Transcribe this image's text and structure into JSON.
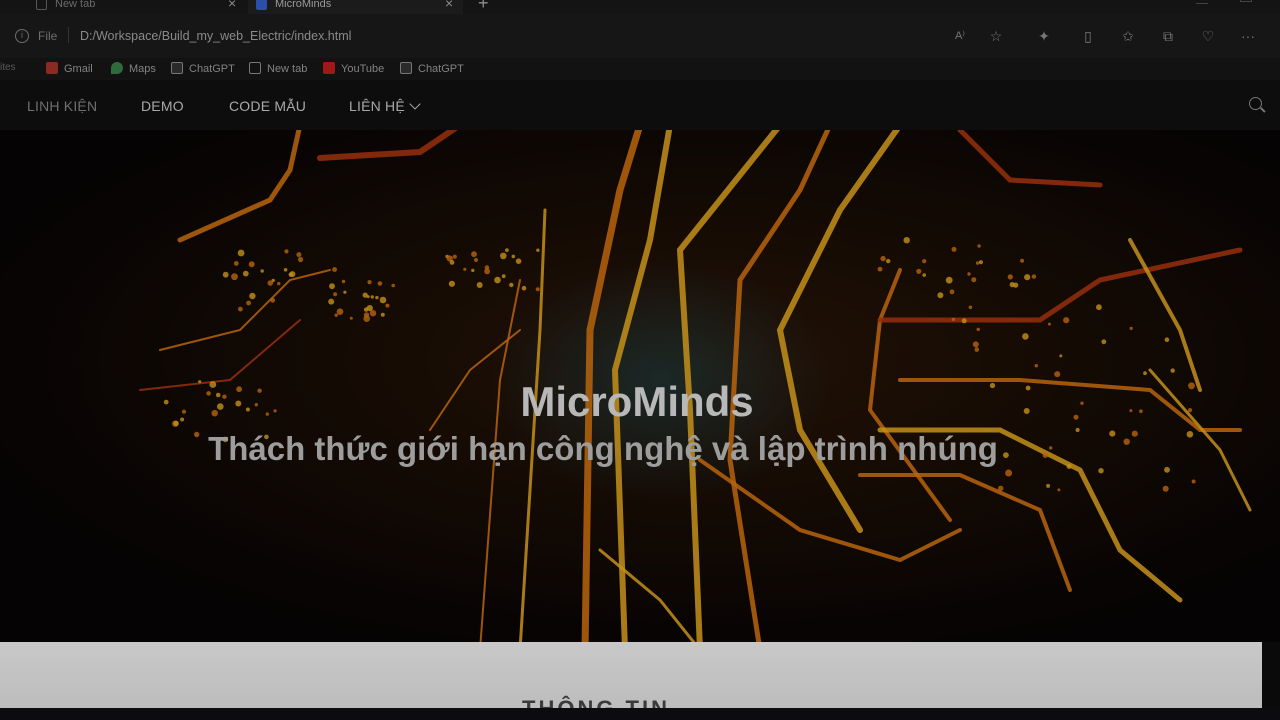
{
  "browser": {
    "tabs": [
      {
        "title": "New tab",
        "active": false
      },
      {
        "title": "MicroMinds",
        "active": true
      }
    ],
    "address": {
      "scheme_label": "File",
      "url": "D:/Workspace/Build_my_web_Electric/index.html"
    },
    "bookmarks_stub": "ites",
    "bookmarks": [
      {
        "label": "Gmail",
        "icon": "gmail-icon"
      },
      {
        "label": "Maps",
        "icon": "maps-icon"
      },
      {
        "label": "ChatGPT",
        "icon": "chatgpt-icon"
      },
      {
        "label": "New tab",
        "icon": "newtab-icon"
      },
      {
        "label": "YouTube",
        "icon": "youtube-icon"
      },
      {
        "label": "ChatGPT",
        "icon": "chatgpt-icon"
      }
    ]
  },
  "site": {
    "nav": [
      {
        "label": "LINH KIỆN"
      },
      {
        "label": "DEMO"
      },
      {
        "label": "CODE MẪU"
      },
      {
        "label": "LIÊN HỆ"
      }
    ],
    "hero": {
      "title": "MicroMinds",
      "subtitle": "Thách thức giới hạn công nghệ và lập trình nhúng"
    },
    "info_heading": "THÔNG TIN"
  },
  "colors": {
    "trace_orange": "#e07a10",
    "trace_yellow": "#f0b020",
    "trace_red": "#b83a10",
    "hero_bg": "#0a0604"
  }
}
